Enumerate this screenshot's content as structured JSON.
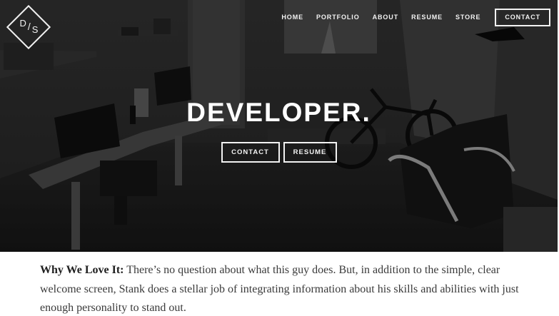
{
  "logo": {
    "left": "D",
    "slash": "/",
    "right": "S"
  },
  "nav": {
    "items": [
      {
        "label": "HOME"
      },
      {
        "label": "PORTFOLIO"
      },
      {
        "label": "ABOUT"
      },
      {
        "label": "RESUME"
      },
      {
        "label": "STORE"
      }
    ],
    "cta_label": "CONTACT"
  },
  "hero": {
    "headline": "DEVELOPER.",
    "buttons": {
      "contact_label": "CONTACT",
      "resume_label": "RESUME"
    }
  },
  "caption": {
    "lead": "Why We Love It:",
    "body": " There’s no question about what this guy does. But, in addition to the simple, clear welcome screen, Stank does a stellar job of integrating information about his skills and abilities with just enough personality to stand out."
  },
  "colors": {
    "hero_overlay": "#1c1c1c",
    "text_light": "#f2f2f2",
    "caption_text": "#3a3a3a"
  }
}
